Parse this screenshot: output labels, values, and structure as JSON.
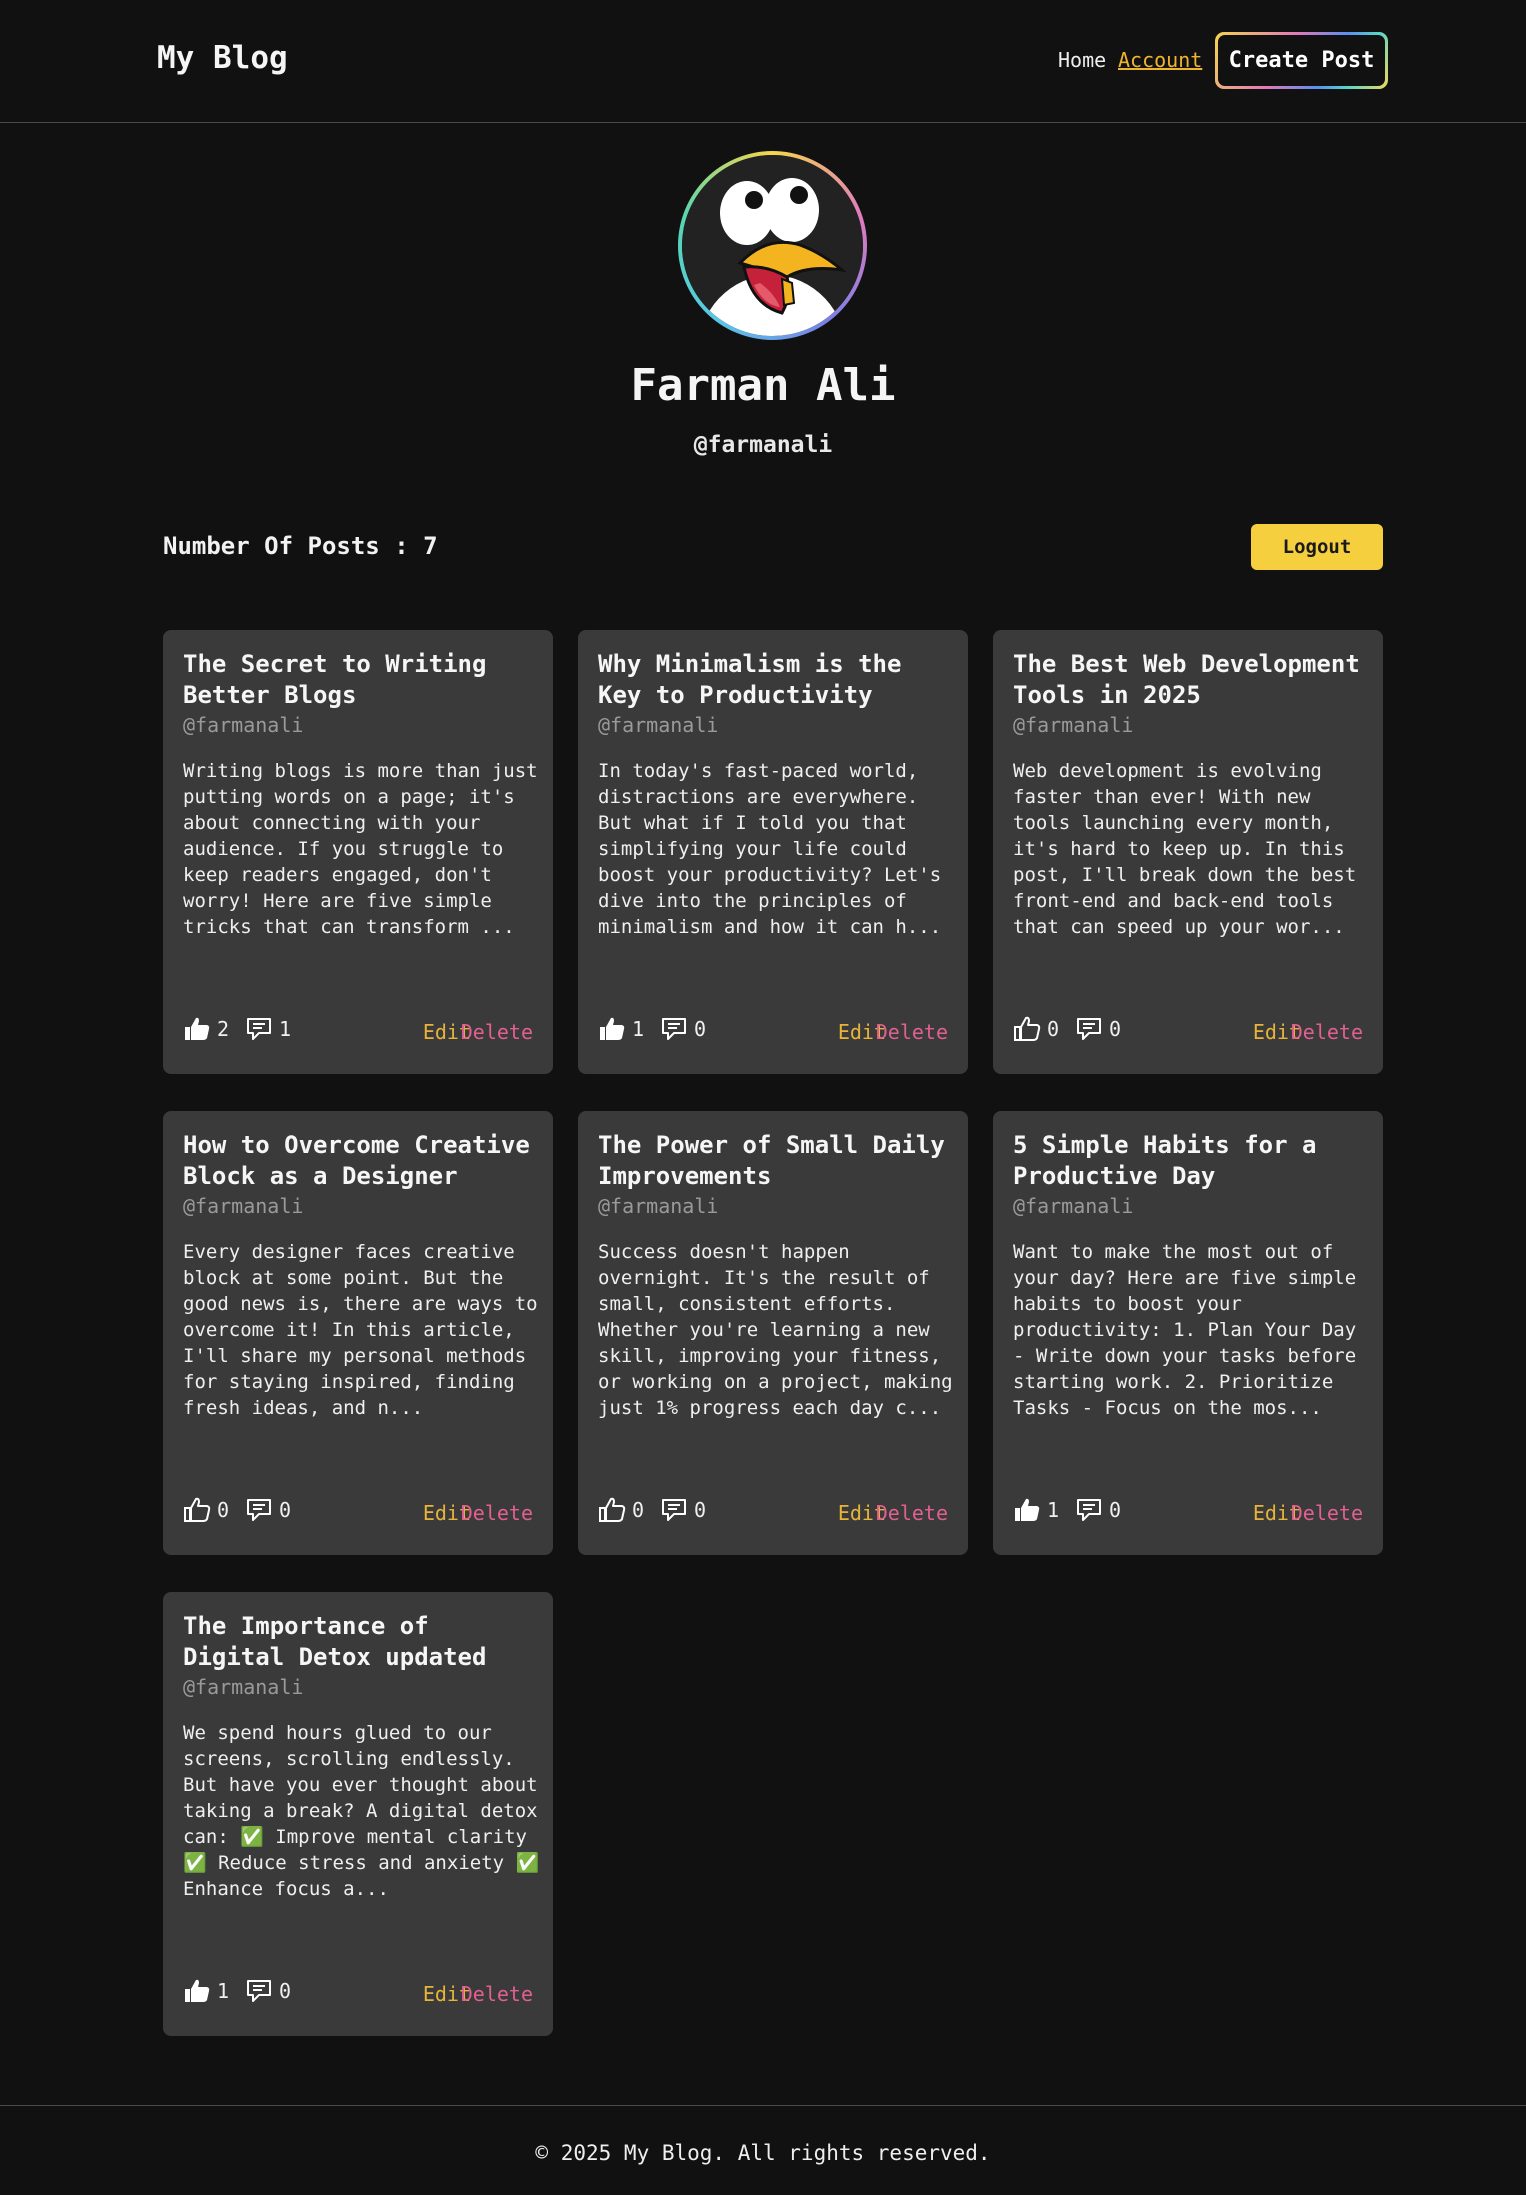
{
  "header": {
    "brand": "My Blog",
    "nav_home": "Home",
    "nav_account": "Account",
    "create_post": "Create Post"
  },
  "profile": {
    "name": "Farman Ali",
    "handle": "@farmanali",
    "avatar_icon": "penguin-avatar-icon"
  },
  "stats": {
    "posts_count_label": "Number Of Posts : 7"
  },
  "logout_label": "Logout",
  "card_actions": {
    "edit": "Edit",
    "delete": "Delete"
  },
  "posts": [
    {
      "title": "The Secret to Writing Better Blogs",
      "author": "@farmanali",
      "excerpt": "Writing blogs is more than just putting words on a page; it's about connecting with your audience. If you struggle to keep readers engaged, don't worry! Here are five simple tricks that can transform ...",
      "likes": "2",
      "comments": "1",
      "liked": true
    },
    {
      "title": "Why Minimalism is the Key to Productivity",
      "author": "@farmanali",
      "excerpt": "In today's fast-paced world, distractions are everywhere. But what if I told you that simplifying your life could boost your productivity? Let's dive into the principles of minimalism and how it can h...",
      "likes": "1",
      "comments": "0",
      "liked": true
    },
    {
      "title": "The Best Web Development Tools in 2025",
      "author": "@farmanali",
      "excerpt": "Web development is evolving faster than ever! With new tools launching every month, it's hard to keep up. In this post, I'll break down the best front-end and back-end tools that can speed up your wor...",
      "likes": "0",
      "comments": "0",
      "liked": false
    },
    {
      "title": "How to Overcome Creative Block as a Designer",
      "author": "@farmanali",
      "excerpt": "Every designer faces creative block at some point. But the good news is, there are ways to overcome it! In this article, I'll share my personal methods for staying inspired, finding fresh ideas, and n...",
      "likes": "0",
      "comments": "0",
      "liked": false
    },
    {
      "title": "The Power of Small Daily Improvements",
      "author": "@farmanali",
      "excerpt": "Success doesn't happen overnight. It's the result of small, consistent efforts. Whether you're learning a new skill, improving your fitness, or working on a project, making just 1% progress each day c...",
      "likes": "0",
      "comments": "0",
      "liked": false
    },
    {
      "title": "5 Simple Habits for a Productive Day",
      "author": "@farmanali",
      "excerpt": "Want to make the most out of your day? Here are five simple habits to boost your productivity: 1. Plan Your Day - Write down your tasks before starting work. 2. Prioritize Tasks - Focus on the mos...",
      "likes": "1",
      "comments": "0",
      "liked": true
    },
    {
      "title": "The Importance of Digital Detox updated",
      "author": "@farmanali",
      "excerpt": "We spend hours glued to our screens, scrolling endlessly. But have you ever thought about taking a break? A digital detox can: ✅ Improve mental clarity ✅ Reduce stress and anxiety ✅ Enhance focus a...",
      "likes": "1",
      "comments": "0",
      "liked": true
    }
  ],
  "footer": {
    "copyright": "© 2025 My Blog. All rights reserved."
  },
  "colors": {
    "background": "#111111",
    "card": "#3a3a3a",
    "accent_yellow": "#f5cf3d",
    "edit": "#e7b43a",
    "delete": "#e0608f"
  }
}
